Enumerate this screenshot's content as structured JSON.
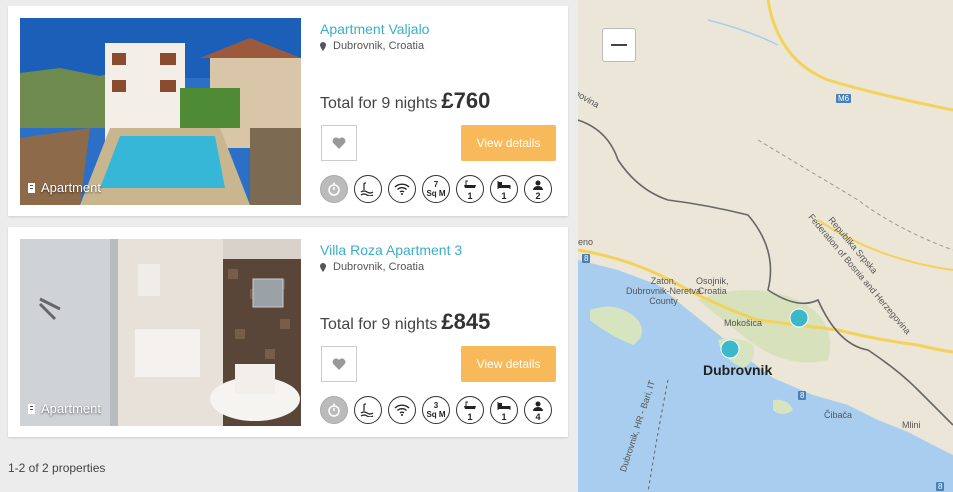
{
  "listings": [
    {
      "title": "Apartment Valjalo",
      "location": "Dubrovnik, Croatia",
      "price_prefix": "Total for 9 nights",
      "price": "£760",
      "type": "Apartment",
      "view_label": "View details",
      "sq_m": "7",
      "sq_unit": "Sq M",
      "baths": "1",
      "beds": "1",
      "guests": "2"
    },
    {
      "title": "Villa Roza Apartment 3",
      "location": "Dubrovnik, Croatia",
      "price_prefix": "Total for 9 nights",
      "price": "£845",
      "type": "Apartment",
      "view_label": "View details",
      "sq_m": "3",
      "sq_unit": "Sq M",
      "baths": "1",
      "beds": "1",
      "guests": "4"
    }
  ],
  "results_count": "1-2 of 2 properties",
  "map": {
    "labels": {
      "osojnik": "Osojnik,",
      "croatia": "Croatia",
      "zaton": "Zaton,",
      "zaton2": "Dubrovnik-Neretva",
      "zaton3": "County",
      "mokosica": "Mokošica",
      "dubrovnik": "Dubrovnik",
      "cibaca": "Čibača",
      "mlini": "Mlini",
      "rs1": "Republika Srpska",
      "rs2": "Federation of Bosnia and Herzegovina",
      "ferry": "Dubrovnik, HR - Bari, IT",
      "govina": "govina",
      "eno": "eno",
      "m6": "M6",
      "r8a": "8",
      "r8b": "8",
      "r8c": "8"
    }
  },
  "colors": {
    "accent": "#3aaec8",
    "button": "#f7b95a",
    "marker": "#3bb8c9"
  }
}
